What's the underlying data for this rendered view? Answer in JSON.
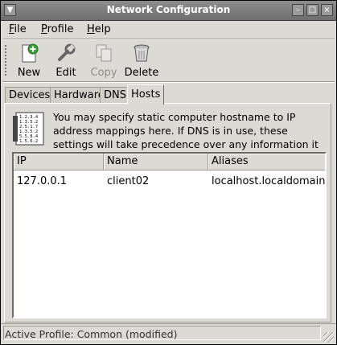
{
  "window": {
    "title": "Network Configuration"
  },
  "menubar": {
    "items": [
      {
        "label": "File",
        "mnemonic": "F"
      },
      {
        "label": "Profile",
        "mnemonic": "P"
      },
      {
        "label": "Help",
        "mnemonic": "H"
      }
    ]
  },
  "toolbar": {
    "new_label": "New",
    "edit_label": "Edit",
    "copy_label": "Copy",
    "delete_label": "Delete"
  },
  "tabs": [
    {
      "label": "Devices",
      "active": false
    },
    {
      "label": "Hardware",
      "active": false
    },
    {
      "label": "DNS",
      "active": false
    },
    {
      "label": "Hosts",
      "active": true
    }
  ],
  "hosts": {
    "description": "You may specify static computer hostname to IP address mappings here.  If DNS is in use, these settings will take precedence over any information it may provide.",
    "icon_lines": [
      "1.2.3.4",
      "1.3.5.2",
      "2.5.1.7",
      "1.3.5.2",
      "5.5.8.4",
      "1.5.6.2"
    ],
    "columns": [
      "IP",
      "Name",
      "Aliases"
    ],
    "rows": [
      {
        "ip": "127.0.0.1",
        "name": "client02",
        "aliases": "localhost.localdomain localhost"
      }
    ]
  },
  "status": {
    "text": "Active Profile: Common (modified)"
  },
  "colors": {
    "window_bg": "#dcdad5",
    "titlebar": "#7e7e7e",
    "list_bg": "#ffffff"
  }
}
